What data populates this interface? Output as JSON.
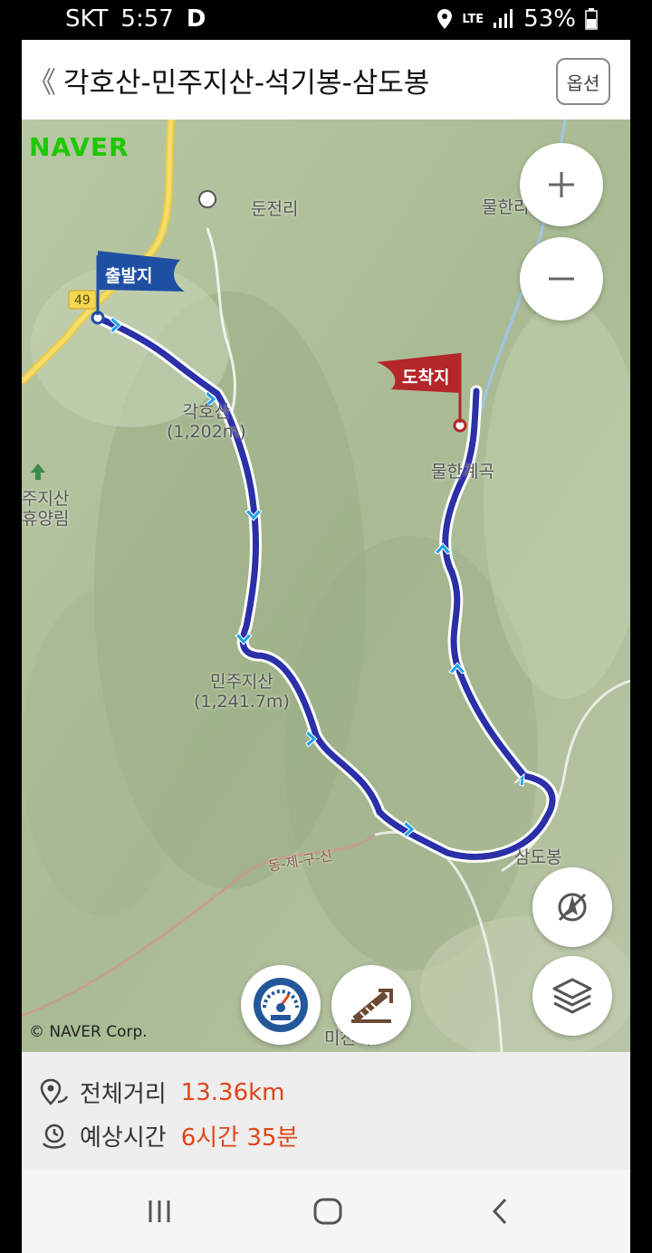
{
  "status_bar": {
    "carrier": "SKT",
    "time": "5:57",
    "app_indicator": "D",
    "network": "LTE",
    "battery": "53%"
  },
  "header": {
    "back_icon": "chevron-left-icon",
    "back_glyph": "《",
    "title": "각호산-민주지산-석기봉-삼도봉",
    "option_label": "옵션"
  },
  "map": {
    "logo": "NAVER",
    "places": {
      "dunjeonri": "둔전리",
      "mulhanri": "물한리",
      "gakhosan_name": "각호산",
      "gakhosan_height": "(1,202m)",
      "minjujisan_name": "민주지산",
      "minjujisan_height": "(1,241.7m)",
      "mulhan_valley": "물한계곡",
      "samdobong": "삼도봉",
      "forest_line1": "주지산",
      "forest_line2": "휴양림",
      "mincheon": "미천리",
      "road_number": "49",
      "trail_label": "동-제-구-신"
    },
    "start_flag": "출발지",
    "end_flag": "도착지",
    "zoom_in_icon": "plus-icon",
    "zoom_out_icon": "minus-icon",
    "compass_icon": "compass-off-icon",
    "layers_icon": "layers-icon",
    "gauge_icon": "speedometer-icon",
    "elevation_icon": "elevation-profile-icon",
    "copyright": "© NAVER Corp.",
    "route_color": "#2b2fa8",
    "start_flag_color": "#1f4fa3",
    "end_flag_color": "#b3262a"
  },
  "route_info": {
    "distance_label": "전체거리",
    "distance_value": "13.36km",
    "time_label": "예상시간",
    "time_value": "6시간 35분",
    "accent_color": "#e0451b"
  },
  "nav_bar": {
    "recent_icon": "recent-apps-icon",
    "home_icon": "home-icon",
    "back_icon": "back-icon"
  }
}
